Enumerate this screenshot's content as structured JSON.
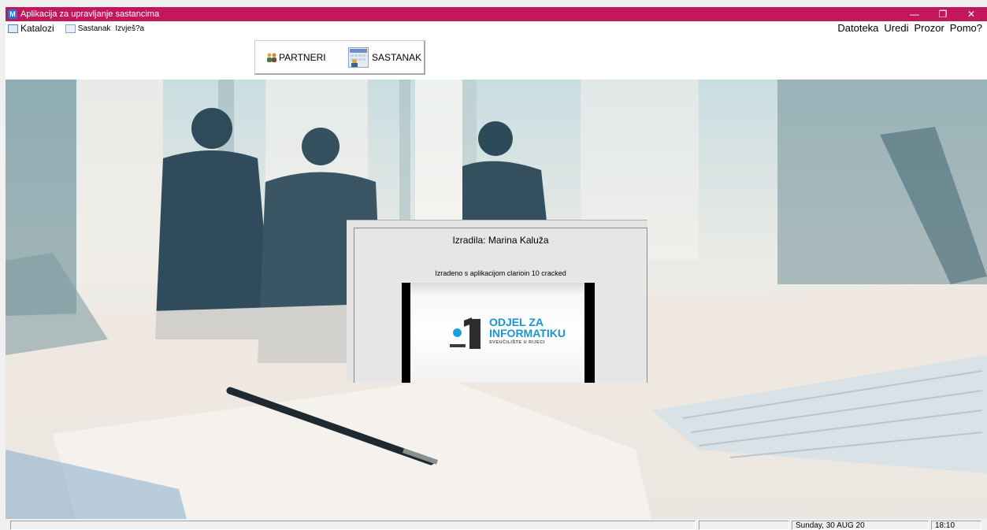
{
  "window": {
    "title": "Aplikacija za upravljanje sastancima",
    "app_icon": "M",
    "controls": {
      "minimize": "—",
      "restore": "❐",
      "close": "✕"
    }
  },
  "menubar": {
    "left": [
      {
        "label": "Katalozi",
        "icon": "catalog-icon"
      },
      {
        "label": "Sastanak",
        "icon": "meeting-icon"
      },
      {
        "label": "Izvješ?a"
      }
    ],
    "right": [
      "Datoteka",
      "Uredi",
      "Prozor",
      "Pomo?"
    ]
  },
  "toolbar": {
    "partneri_label": "PARTNERI",
    "sastanak_label": "SASTANAK"
  },
  "dialog": {
    "title": "Izradila: Marina Kaluža",
    "subtitle": "Izradeno s aplikacijom clarioin 10 cracked",
    "logo": {
      "line1": "ODJEL ZA",
      "line2": "INFORMATIKU",
      "line3": "SVEUČILIŠTE U RIJECI"
    }
  },
  "statusbar": {
    "date": "Sunday, 30 AUG 20",
    "time": "18:10"
  },
  "colors": {
    "titlebar": "#c2185b",
    "logo_blue": "#1a94d1"
  }
}
